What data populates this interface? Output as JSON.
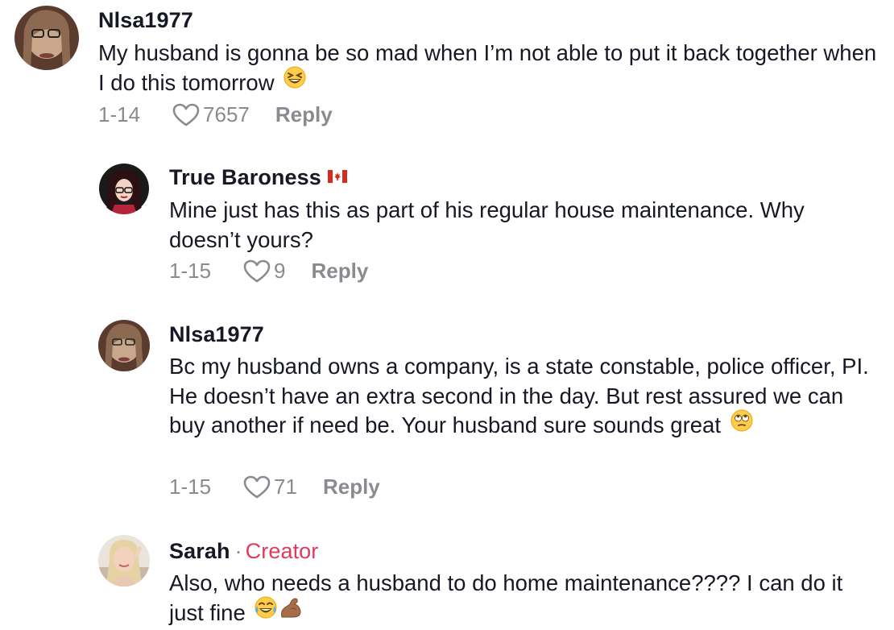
{
  "comments": [
    {
      "username": "Nlsa1977",
      "text": "My husband is gonna be so mad when I’m not able to put it back together when I do this tomorrow",
      "emoji": "laughing-squint-emoji",
      "date": "1-14",
      "likes": "7657",
      "reply_label": "Reply"
    },
    {
      "username": "True Baroness",
      "flag": "canada-flag",
      "text": "Mine just has this as part of his regular house maintenance. Why doesn’t yours?",
      "date": "1-15",
      "likes": "9",
      "reply_label": "Reply"
    },
    {
      "username": "Nlsa1977",
      "text": "Bc my husband owns a company, is a state constable, police officer, PI. He doesn’t have an extra second in the day. But rest assured we can buy another if need be. Your husband sure sounds great",
      "emoji": "eye-roll-emoji",
      "date": "1-15",
      "likes": "71",
      "reply_label": "Reply"
    },
    {
      "username": "Sarah",
      "creator_separator": "·",
      "creator_label": "Creator",
      "text": "Also, who needs a husband to do home maintenance???? I can do it just fine",
      "emoji": "tears-of-joy-and-flexed-arm-emoji"
    }
  ],
  "colors": {
    "text": "#161823",
    "meta": "#8a8b91",
    "creator": "#e03b5b"
  }
}
